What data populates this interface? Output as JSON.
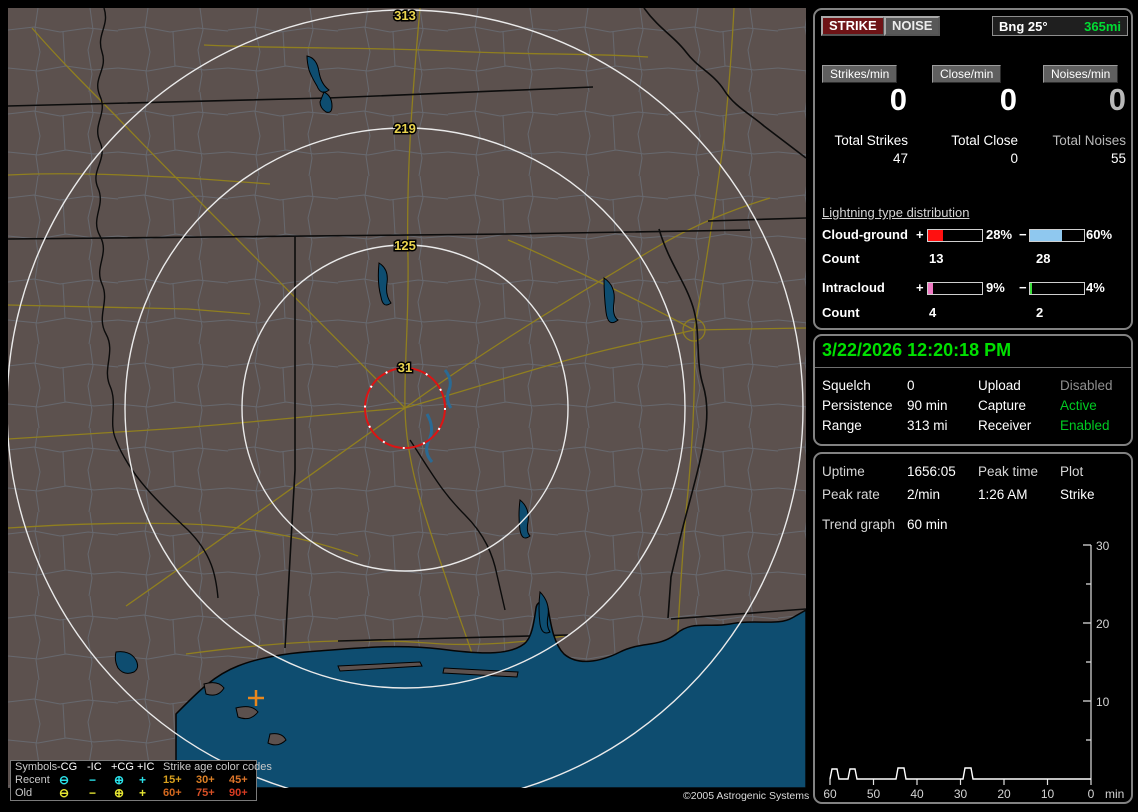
{
  "map": {
    "ring_labels": [
      "313",
      "219",
      "125",
      "31"
    ],
    "copyright": "©2005 Astrogenic Systems",
    "strike_marker": {
      "symbol": "+IC",
      "color": "#e8871e"
    },
    "colors": {
      "land": "#5c514e",
      "water": "#0e4d70",
      "roads": "#907f1f",
      "rings": "#eaeaea",
      "close_ring": "#dd1414",
      "ring_label": "#ead44e"
    },
    "legend": {
      "symbols_header": "Symbols",
      "type_headers": [
        "-CG",
        "-IC",
        "+CG",
        "+IC"
      ],
      "age_header": "Strike age color codes",
      "symbol_glyphs": [
        "⊖",
        "−",
        "⊕",
        "+"
      ],
      "rows": [
        {
          "label": "Recent",
          "symbol_color": "#2ae0e8",
          "ages": [
            {
              "text": "15+",
              "color": "#d9a11e"
            },
            {
              "text": "30+",
              "color": "#dd8126"
            },
            {
              "text": "45+",
              "color": "#dd7429"
            }
          ]
        },
        {
          "label": "Old",
          "symbol_color": "#e4e432",
          "ages": [
            {
              "text": "60+",
              "color": "#d5691f"
            },
            {
              "text": "75+",
              "color": "#d64f26"
            },
            {
              "text": "90+",
              "color": "#d63b22"
            }
          ]
        }
      ]
    }
  },
  "panel1": {
    "strike_button": "STRIKE",
    "noise_button": "NOISE",
    "bearing": "Bng 25°",
    "distance": "365mi",
    "stats": [
      {
        "rate_label": "Strikes/min",
        "rate": "0",
        "total_label": "Total Strikes",
        "total": "47"
      },
      {
        "rate_label": "Close/min",
        "rate": "0",
        "total_label": "Total Close",
        "total": "0"
      },
      {
        "rate_label": "Noises/min",
        "rate": "0",
        "total_label": "Total Noises",
        "total": "55"
      }
    ],
    "distribution": {
      "title": "Lightning type distribution",
      "count_label": "Count",
      "rows": [
        {
          "label": "Cloud-ground",
          "plus_sign": "+",
          "plus_pct": "28%",
          "plus_pct_num": 28,
          "plus_color": "#ff1010",
          "plus_count": "13",
          "minus_sign": "−",
          "minus_pct": "60%",
          "minus_pct_num": 60,
          "minus_color": "#8fc8ef",
          "minus_count": "28"
        },
        {
          "label": "Intracloud",
          "plus_sign": "+",
          "plus_pct": "9%",
          "plus_pct_num": 9,
          "plus_color": "#f07ac4",
          "plus_count": "4",
          "minus_sign": "−",
          "minus_pct": "4%",
          "minus_pct_num": 4,
          "minus_color": "#3ddd3d",
          "minus_count": "2"
        }
      ]
    }
  },
  "panel2": {
    "datetime": "3/22/2026 12:20:18 PM",
    "rows": [
      {
        "label1": "Squelch",
        "value1": "0",
        "label2": "Upload",
        "value2": "Disabled",
        "value2_color": "#8f8f8f"
      },
      {
        "label1": "Persistence",
        "value1": "90 min",
        "label2": "Capture",
        "value2": "Active",
        "value2_color": "#00cc22"
      },
      {
        "label1": "Range",
        "value1": "313 mi",
        "label2": "Receiver",
        "value2": "Enabled",
        "value2_color": "#00cc22"
      }
    ]
  },
  "panel3": {
    "rows": [
      {
        "c0": "Uptime",
        "c1": "1656:05",
        "c2": "Peak time",
        "c3": "Plot"
      },
      {
        "c0": "Peak rate",
        "c1": "2/min",
        "c2": "1:26 AM",
        "c3": "Strike"
      }
    ],
    "trend_label": "Trend graph",
    "trend_value": "60 min",
    "chart": {
      "type": "line",
      "title": "Strike rate trend",
      "x_unit": "min",
      "x_ticks": [
        "60",
        "50",
        "40",
        "30",
        "20",
        "10",
        "0"
      ],
      "y_ticks": [
        "30",
        "20",
        "10"
      ],
      "y_range": [
        0,
        30
      ],
      "x_range_min_ago": [
        60,
        0
      ],
      "events": [
        {
          "min_ago": 59,
          "rate": 2
        },
        {
          "min_ago": 55,
          "rate": 2
        },
        {
          "min_ago": 44,
          "rate": 2
        },
        {
          "min_ago": 28,
          "rate": 2
        }
      ]
    }
  }
}
